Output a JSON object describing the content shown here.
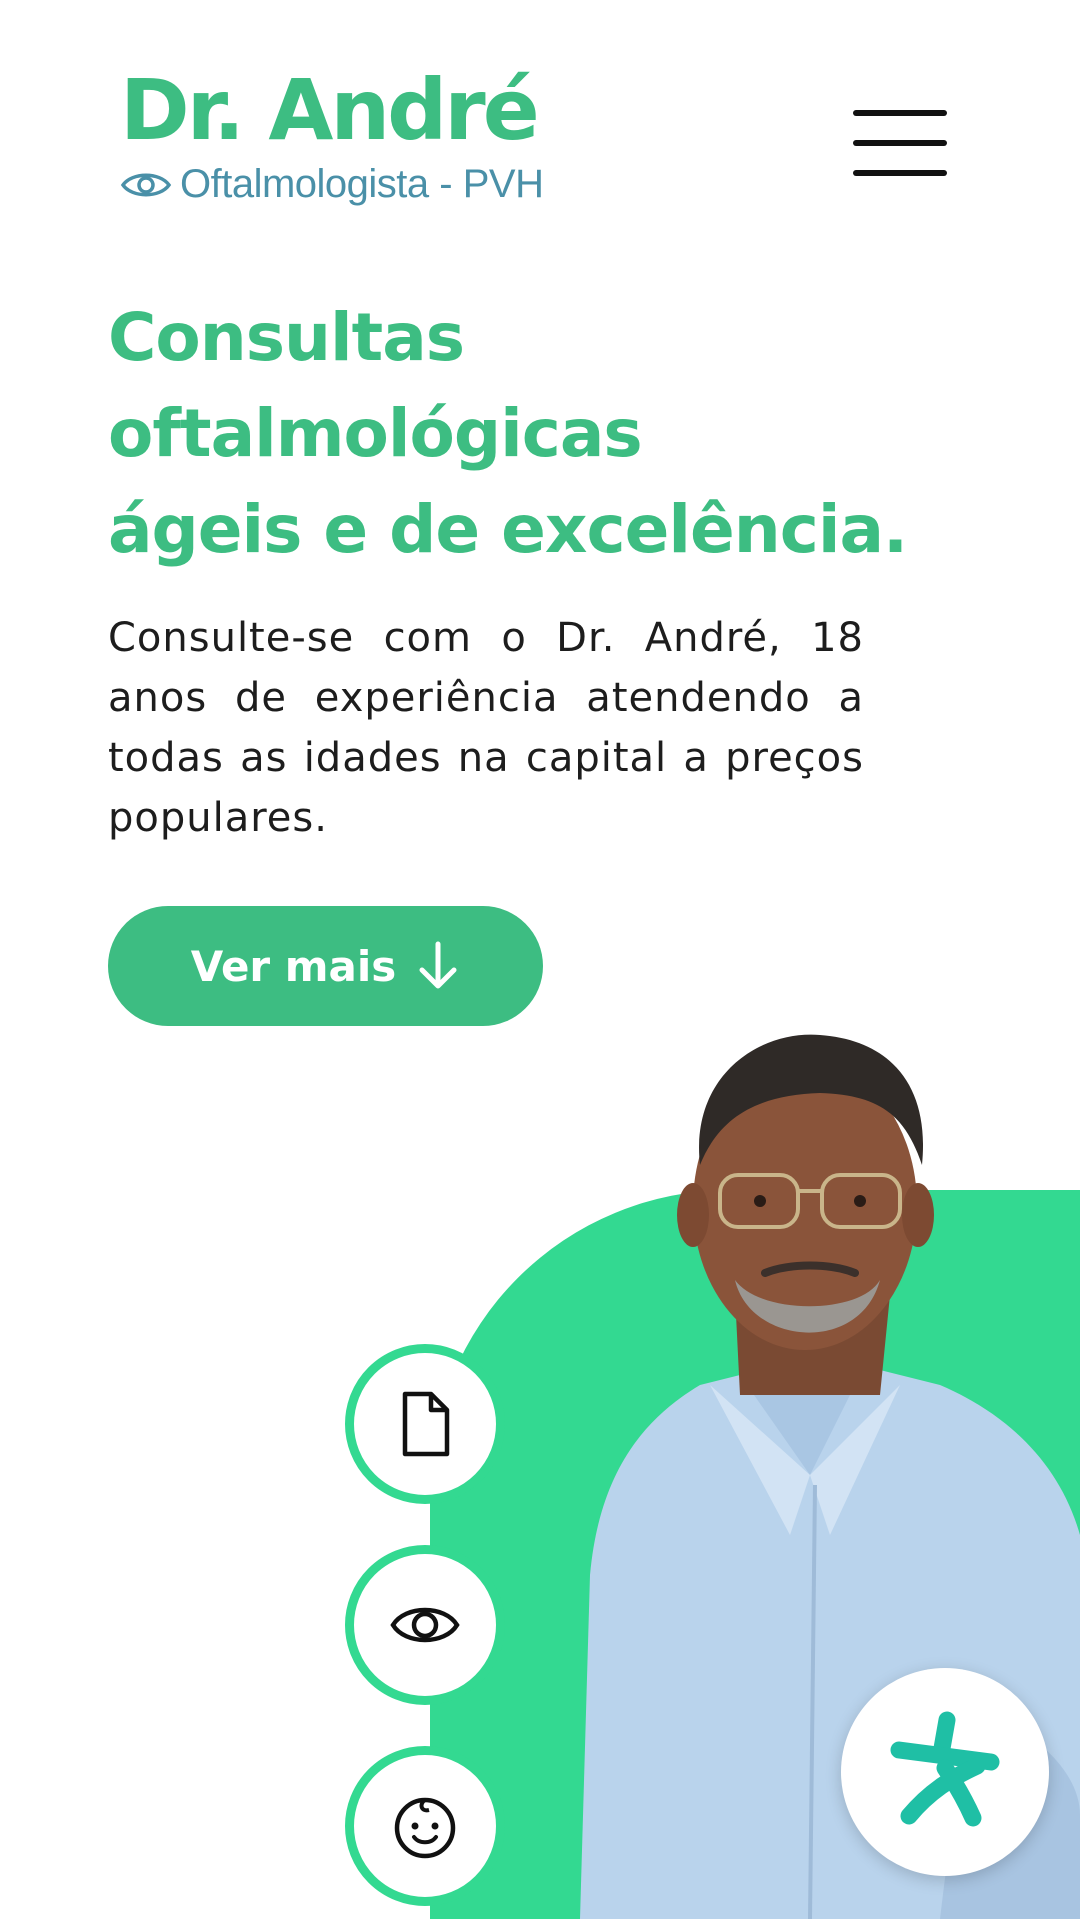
{
  "header": {
    "brand_name": "Dr. André",
    "brand_subtitle": "Oftalmologista - PVH",
    "menu_icon": "hamburger-menu-icon"
  },
  "hero": {
    "title_lines": [
      "Consultas",
      "oftalmológicas",
      "ágeis e de excelência."
    ],
    "description": "Consulte-se com o Dr. André, 18 anos de experiência atendendo a todas as idades na capital a preços populares.",
    "cta_label": "Ver mais",
    "cta_icon": "arrow-down-icon"
  },
  "features": [
    {
      "icon": "document-icon"
    },
    {
      "icon": "eye-icon"
    },
    {
      "icon": "baby-face-icon"
    }
  ],
  "fab": {
    "icon": "doctoralia-logo-icon"
  },
  "colors": {
    "brand_green": "#3dbd82",
    "accent_green": "#33d991",
    "subtitle_blue": "#4a90a8",
    "text": "#1d1d1d"
  }
}
